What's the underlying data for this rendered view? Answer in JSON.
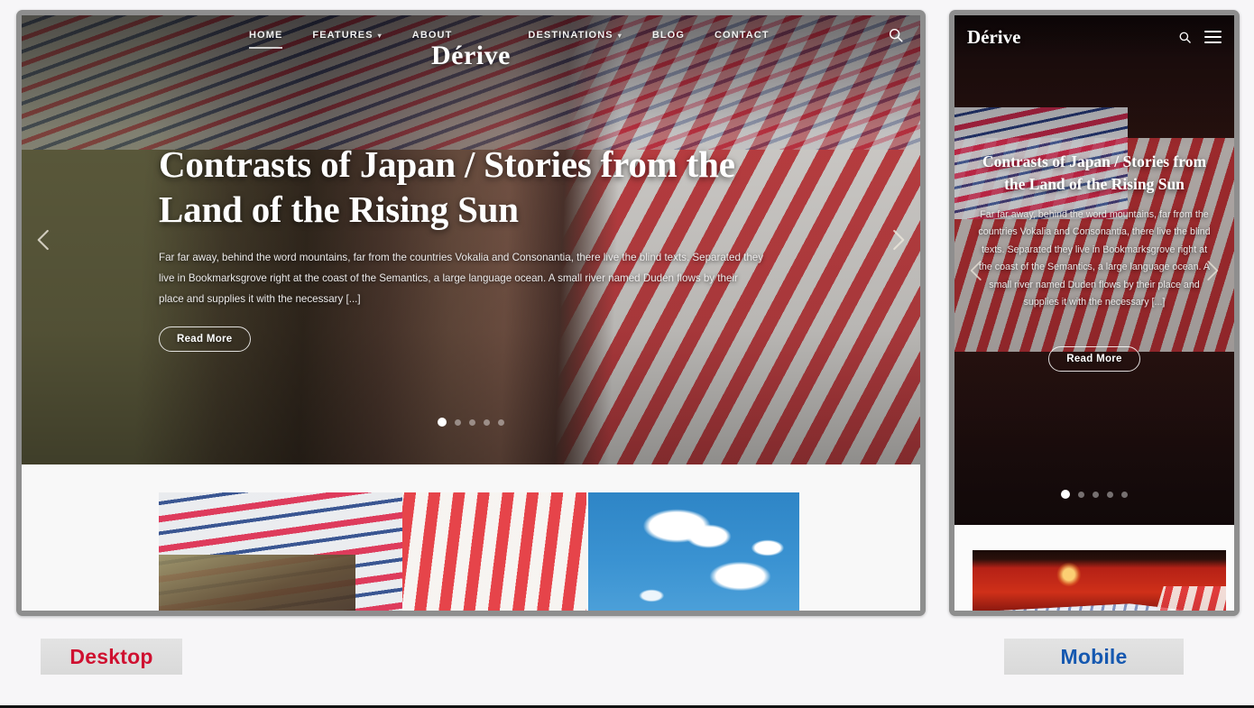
{
  "page": {
    "background_color": "#f7f6f8",
    "frame_color": "#8e8e8e"
  },
  "toggles": {
    "desktop": {
      "label": "Desktop",
      "color": "#cf1030"
    },
    "mobile": {
      "label": "Mobile",
      "color": "#1558b0"
    }
  },
  "desktop_preview": {
    "brand": "Dérive",
    "nav_left": [
      {
        "label": "HOME",
        "active": true,
        "has_caret": false
      },
      {
        "label": "FEATURES",
        "active": false,
        "has_caret": true
      },
      {
        "label": "ABOUT",
        "active": false,
        "has_caret": false
      }
    ],
    "nav_right": [
      {
        "label": "DESTINATIONS",
        "active": false,
        "has_caret": true
      },
      {
        "label": "BLOG",
        "active": false,
        "has_caret": false
      },
      {
        "label": "CONTACT",
        "active": false,
        "has_caret": false
      }
    ],
    "search_icon": "search-icon",
    "hero": {
      "title": "Contrasts of Japan / Stories from the Land of the Rising Sun",
      "paragraph": "Far far away, behind the word mountains, far from the countries Vokalia and Consonantia, there live the blind texts. Separated they live in Bookmarksgrove right at the coast of the Semantics, a large language ocean. A small river named Duden flows by their place and supplies it with the necessary [...]",
      "cta_label": "Read More",
      "prev_icon": "chevron-left-icon",
      "next_icon": "chevron-right-icon",
      "dots_total": 5,
      "dots_active_index": 0
    },
    "cards": [
      {
        "name": "umbrella-photo"
      },
      {
        "name": "sky-clouds-photo"
      }
    ]
  },
  "mobile_preview": {
    "brand": "Dérive",
    "search_icon": "search-icon",
    "menu_icon": "hamburger-menu-icon",
    "hero": {
      "title": "Contrasts of Japan / Stories from the Land of the Rising Sun",
      "paragraph": "Far far away, behind the word mountains, far from the countries Vokalia and Consonantia, there live the blind texts. Separated they live in Bookmarksgrove right at the coast of the Semantics, a large language ocean. A small river named Duden flows by their place and supplies it with the necessary [...]",
      "cta_label": "Read More",
      "prev_icon": "chevron-left-icon",
      "next_icon": "chevron-right-icon",
      "dots_total": 5,
      "dots_active_index": 0
    },
    "cards": [
      {
        "name": "lantern-photo"
      }
    ]
  }
}
